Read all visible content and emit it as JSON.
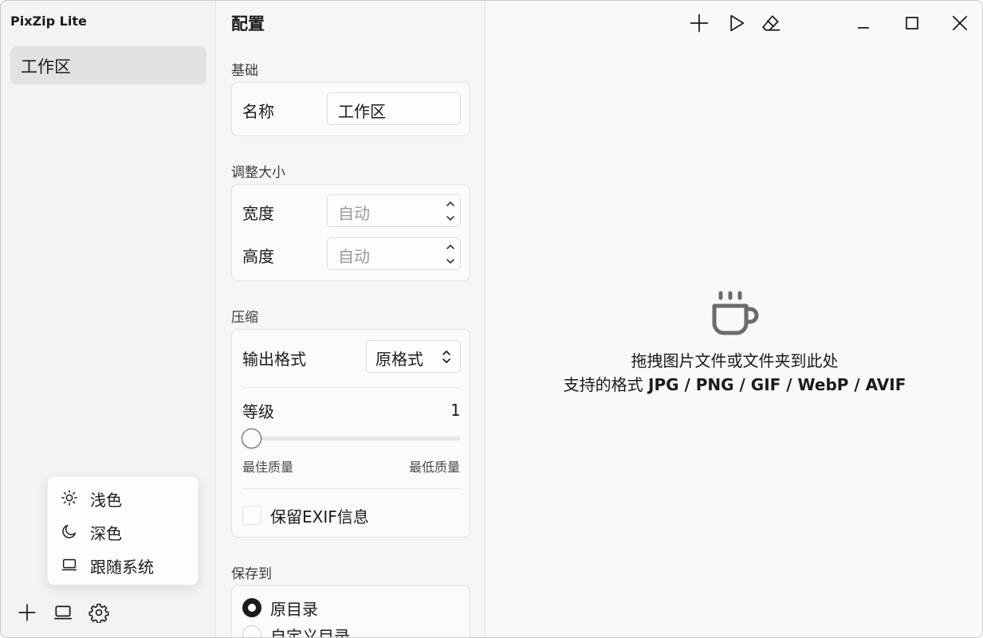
{
  "app": {
    "title": "PixZip Lite"
  },
  "sidebar": {
    "workspaces": [
      {
        "label": "工作区",
        "selected": true
      }
    ],
    "theme_menu": {
      "items": [
        {
          "label": "浅色",
          "icon": "sun-icon"
        },
        {
          "label": "深色",
          "icon": "moon-icon"
        },
        {
          "label": "跟随系统",
          "icon": "laptop-icon"
        }
      ]
    },
    "bottom_bar": {
      "icons": [
        "plus-icon",
        "laptop-icon",
        "gear-icon"
      ]
    }
  },
  "config": {
    "title": "配置",
    "basic": {
      "section_label": "基础",
      "name_label": "名称",
      "name_value": "工作区"
    },
    "resize": {
      "section_label": "调整大小",
      "width_label": "宽度",
      "width_placeholder": "自动",
      "height_label": "高度",
      "height_placeholder": "自动"
    },
    "compress": {
      "section_label": "压缩",
      "format_label": "输出格式",
      "format_value": "原格式",
      "level_label": "等级",
      "level_value": "1",
      "level_fraction": 0.0,
      "best_label": "最佳质量",
      "worst_label": "最低质量",
      "exif_label": "保留EXIF信息",
      "exif_checked": false
    },
    "save": {
      "section_label": "保存到",
      "options": [
        {
          "label": "原目录",
          "selected": true
        },
        {
          "label": "自定义目录",
          "selected": false
        }
      ]
    }
  },
  "main": {
    "toolbar_icons": [
      "plus-icon",
      "play-icon",
      "eraser-icon"
    ],
    "window_controls": [
      "minimize-icon",
      "maximize-icon",
      "close-icon"
    ],
    "drop_hint": "拖拽图片文件或文件夹到此处",
    "formats_prefix": "支持的格式",
    "formats_list": "JPG / PNG / GIF / WebP / AVIF",
    "empty_icon": "coffee-cup-icon"
  },
  "colors": {
    "accent": "#1b1b1b",
    "background": "#f9f9f9",
    "sidebar": "#f3f3f3",
    "selected": "#e2e2e2"
  }
}
